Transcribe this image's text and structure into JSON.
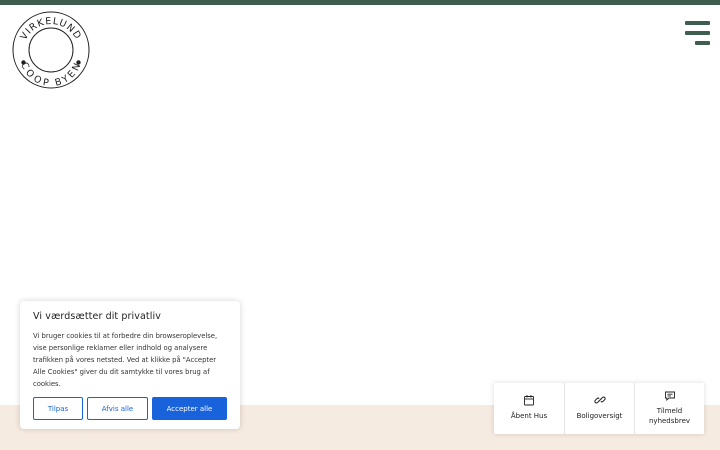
{
  "logo": {
    "top_text": "VIRKELUND",
    "bottom_text": "COOP BYEN"
  },
  "header": {
    "menu_icon": "hamburger-icon",
    "accent_color": "#3f5e50"
  },
  "cookie_banner": {
    "title": "Vi værdsætter dit privatliv",
    "body_lines": [
      "Vi bruger cookies til at forbedre din browseroplevelse,",
      "vise personlige reklamer eller indhold og analysere",
      "trafikken på vores netsted. Ved at klikke på \"Accepter",
      "Alle Cookies\" giver du dit samtykke til vores brug af",
      "cookies."
    ],
    "buttons": {
      "customize": "Tilpas",
      "reject": "Afvis alle",
      "accept": "Accepter alle"
    },
    "button_color": "#1863dc"
  },
  "quick_links": [
    {
      "icon": "calendar-icon",
      "label": "Åbent Hus"
    },
    {
      "icon": "link-icon",
      "label": "Boligoversigt"
    },
    {
      "icon": "chat-icon",
      "label_lines": [
        "Tilmeld",
        "nyhedsbrev"
      ]
    }
  ],
  "band_color": "#f6ebe0"
}
